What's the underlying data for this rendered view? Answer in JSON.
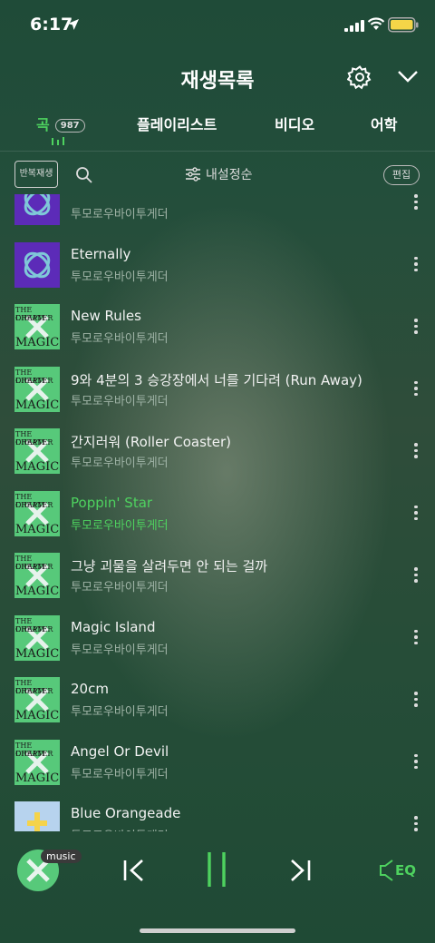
{
  "status_bar": {
    "time": "6:17"
  },
  "header": {
    "title": "재생목록"
  },
  "tabs": [
    {
      "label": "곡",
      "count": "987",
      "active": true
    },
    {
      "label": "플레이리스트"
    },
    {
      "label": "비디오"
    },
    {
      "label": "어학"
    }
  ],
  "toolbar": {
    "repeat_label": "반복재생",
    "sort_label": "내설정순",
    "edit_label": "편집"
  },
  "songs": [
    {
      "title": "",
      "artist": "투모로우바이투게더",
      "art": "purple"
    },
    {
      "title": "Eternally",
      "artist": "투모로우바이투게더",
      "art": "purple"
    },
    {
      "title": "New Rules",
      "artist": "투모로우바이투게더",
      "art": "magic"
    },
    {
      "title": "9와 4분의 3 승강장에서 너를 기다려 (Run Away)",
      "artist": "투모로우바이투게더",
      "art": "magic"
    },
    {
      "title": "간지러워 (Roller Coaster)",
      "artist": "투모로우바이투게더",
      "art": "magic"
    },
    {
      "title": "Poppin' Star",
      "artist": "투모로우바이투게더",
      "art": "magic",
      "playing": true
    },
    {
      "title": "그냥 괴물을 살려두면 안 되는 걸까",
      "artist": "투모로우바이투게더",
      "art": "magic"
    },
    {
      "title": "Magic Island",
      "artist": "투모로우바이투게더",
      "art": "magic"
    },
    {
      "title": "20cm",
      "artist": "투모로우바이투게더",
      "art": "magic"
    },
    {
      "title": "Angel Or Devil",
      "artist": "투모로우바이투게더",
      "art": "magic"
    },
    {
      "title": "Blue Orangeade",
      "artist": "투모로우바이투게더",
      "art": "blue"
    }
  ],
  "album_art_text": [
    "THE DREAM",
    "CHAPTER",
    "MAGIC"
  ],
  "player": {
    "badge": "music",
    "eq_label": "EQ"
  },
  "colors": {
    "accent": "#4ed25f"
  }
}
